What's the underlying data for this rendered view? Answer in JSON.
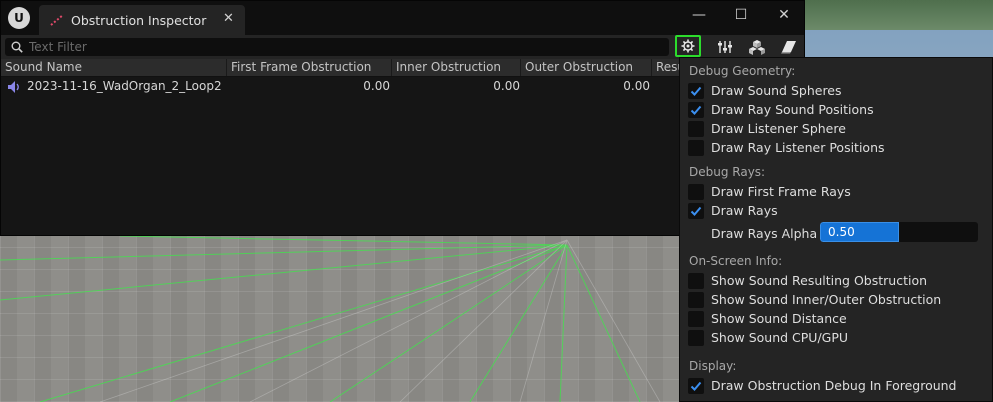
{
  "window": {
    "tab_title": "Obstruction Inspector",
    "close_glyph": "✕",
    "controls": {
      "minimize": "—",
      "maximize": "☐",
      "close": "✕"
    }
  },
  "toolbar": {
    "filter_placeholder": "Text Filter",
    "filter_value": "",
    "buttons": [
      "settings-gear-icon",
      "sliders-icon",
      "cubes-icon",
      "eraser-icon"
    ],
    "active_button": "settings-gear-icon"
  },
  "table": {
    "columns": [
      "Sound Name",
      "First Frame Obstruction",
      "Inner Obstruction",
      "Outer Obstruction",
      "Resu"
    ],
    "rows": [
      {
        "name": "2023-11-16_WadOrgan_2_Loop2",
        "first_frame": "0.00",
        "inner": "0.00",
        "outer": "0.00"
      }
    ]
  },
  "menu": {
    "sections": [
      {
        "title": "Debug Geometry:",
        "items": [
          {
            "label": "Draw Sound Spheres",
            "checked": true
          },
          {
            "label": "Draw Ray Sound Positions",
            "checked": true
          },
          {
            "label": "Draw Listener Sphere",
            "checked": false
          },
          {
            "label": "Draw Ray Listener Positions",
            "checked": false
          }
        ]
      },
      {
        "title": "Debug Rays:",
        "items": [
          {
            "label": "Draw First Frame Rays",
            "checked": false
          },
          {
            "label": "Draw Rays",
            "checked": true
          }
        ],
        "slider": {
          "label": "Draw Rays Alpha",
          "value": "0.50",
          "fraction": 0.5
        }
      },
      {
        "title": "On-Screen Info:",
        "items": [
          {
            "label": "Show Sound Resulting Obstruction",
            "checked": false
          },
          {
            "label": "Show Sound Inner/Outer Obstruction",
            "checked": false
          },
          {
            "label": "Show Sound Distance",
            "checked": false
          },
          {
            "label": "Show Sound CPU/GPU",
            "checked": false
          }
        ]
      },
      {
        "title": "Display:",
        "items": [
          {
            "label": "Draw Obstruction Debug In Foreground",
            "checked": true
          }
        ]
      }
    ]
  },
  "colors": {
    "accent_blue": "#1573d6",
    "highlight_green": "#2cdc2c",
    "check_blue": "#3b8ff0",
    "sound_icon": "#8a86e8"
  }
}
